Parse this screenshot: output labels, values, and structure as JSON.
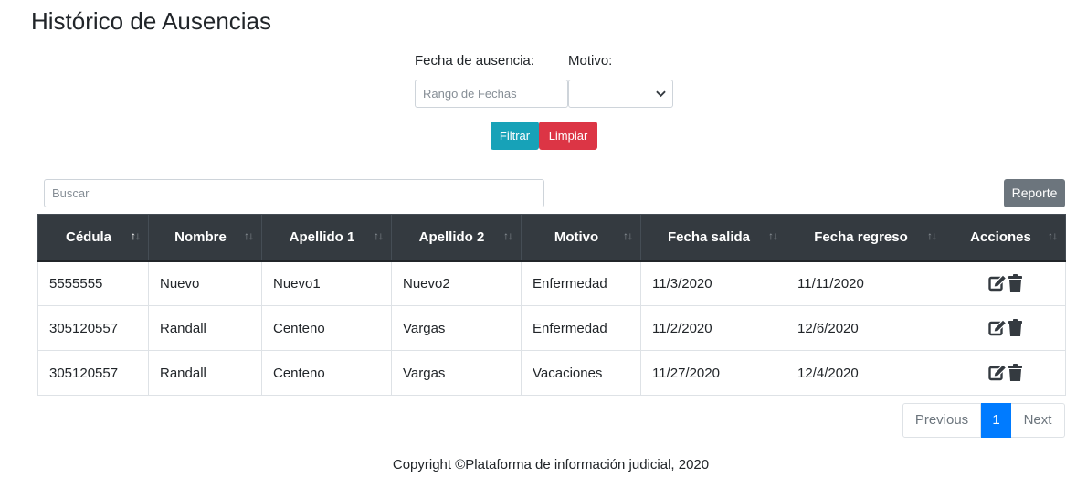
{
  "page": {
    "title": "Histórico de Ausencias"
  },
  "filters": {
    "date_label": "Fecha de ausencia:",
    "date_placeholder": "Rango de Fechas",
    "motivo_label": "Motivo:",
    "motivo_selected": "",
    "filter_button": "Filtrar",
    "clear_button": "Limpiar"
  },
  "toolbar": {
    "search_placeholder": "Buscar",
    "report_button": "Reporte"
  },
  "table": {
    "headers": [
      "Cédula",
      "Nombre",
      "Apellido 1",
      "Apellido 2",
      "Motivo",
      "Fecha salida",
      "Fecha regreso",
      "Acciones"
    ],
    "rows": [
      [
        "5555555",
        "Nuevo",
        "Nuevo1",
        "Nuevo2",
        "Enfermedad",
        "11/3/2020",
        "11/11/2020"
      ],
      [
        "305120557",
        "Randall",
        "Centeno",
        "Vargas",
        "Enfermedad",
        "11/2/2020",
        "12/6/2020"
      ],
      [
        "305120557",
        "Randall",
        "Centeno",
        "Vargas",
        "Vacaciones",
        "11/27/2020",
        "12/4/2020"
      ]
    ],
    "sort_column": "Cédula",
    "sort_direction": "asc",
    "row_action_icons": [
      "edit-icon",
      "trash-icon"
    ]
  },
  "pagination": {
    "previous_label": "Previous",
    "current_page": "1",
    "next_label": "Next"
  },
  "footer": {
    "copyright": "Copyright ©Plataforma de información judicial, 2020"
  },
  "colors": {
    "header_bg": "#343a40",
    "filter_button": "#17a2b8",
    "clear_button": "#dc3545",
    "report_button": "#6c757d",
    "active_page": "#007bff"
  }
}
